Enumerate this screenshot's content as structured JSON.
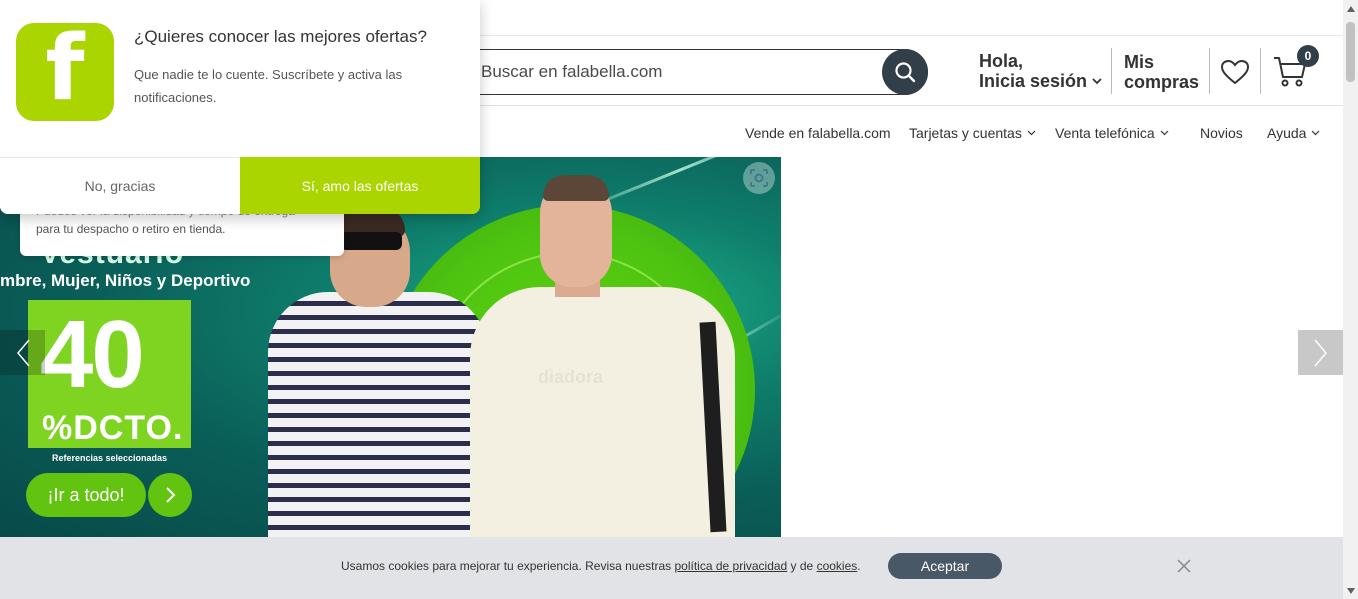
{
  "search": {
    "placeholder": "Buscar en falabella.com",
    "visible_text": "r en falabella.com"
  },
  "account": {
    "greeting": "Hola,",
    "login_label": "Inicia sesión"
  },
  "orders": {
    "line1": "Mis",
    "line2": "compras"
  },
  "cart": {
    "count": "0"
  },
  "nav": {
    "items": [
      {
        "label": "Vende en falabella.com",
        "has_dropdown": false
      },
      {
        "label": "Tarjetas y cuentas",
        "has_dropdown": true
      },
      {
        "label": "Venta telefónica",
        "has_dropdown": true
      },
      {
        "label": "Novios",
        "has_dropdown": false
      },
      {
        "label": "Ayuda",
        "has_dropdown": true
      }
    ]
  },
  "banner": {
    "heading": "Vestuario",
    "subline": "mbre, Mujer, Niños y Deportivo",
    "discount_number": "40",
    "discount_label": "%DCTO.",
    "refs": "Referencias seleccionadas",
    "cta_label": "¡Ir a todo!",
    "shirt_brand": "diadora"
  },
  "availability_tip": {
    "line1": "Puedes ver la disponibilidad y tiempo de entrega",
    "line2": "para tu despacho o retiro en tienda."
  },
  "push_prompt": {
    "logo_letter": "f",
    "title": "¿Quieres conocer las mejores ofertas?",
    "body": "Que nadie te lo cuente. Suscríbete y activa las notificaciones.",
    "decline_label": "No, gracias",
    "accept_label": "Sí, amo las ofertas"
  },
  "cookies": {
    "text_before": "Usamos cookies para mejorar tu experiencia. Revisa nuestras ",
    "privacy_link": "política de privacidad",
    "text_middle": " y de ",
    "cookies_link": "cookies",
    "text_after": ".",
    "accept_label": "Aceptar"
  },
  "colors": {
    "brand_green": "#aad500",
    "banner_green": "#7fd321",
    "dark_slate": "#333f48",
    "cookie_bg": "#e1e3e6",
    "cookie_button": "#495867"
  }
}
